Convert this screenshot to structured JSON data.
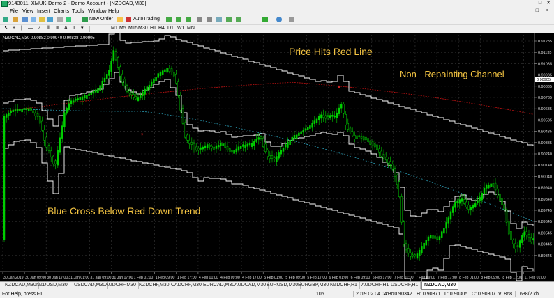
{
  "window": {
    "title": "9143011: XMUK-Demo 2 - Demo Account - [NZDCAD,M30]",
    "controls": [
      "–",
      "□",
      "✕"
    ]
  },
  "menu": {
    "items": [
      "File",
      "View",
      "Insert",
      "Charts",
      "Tools",
      "Window",
      "Help"
    ],
    "mdi_controls": "_ □ ×"
  },
  "toolbar": {
    "new_order": "New Order",
    "autotrading": "AutoTrading",
    "timeframes": [
      "M1",
      "M5",
      "M15",
      "M30",
      "H1",
      "H4",
      "D1",
      "W1",
      "MN"
    ]
  },
  "chart": {
    "header": "NZDCAD,M30  0.90882 0.90940 0.90838 0.90905",
    "annotations": {
      "price_hits": "Price Hits Red Line",
      "channel": "Non - Repainting Channel",
      "blue_cross": "Blue Cross Below Red Down Trend"
    },
    "price_labels": [
      "0.91235",
      "0.91135",
      "0.91035",
      "0.90935",
      "0.90835",
      "0.90735",
      "0.90635",
      "0.90535",
      "0.90435",
      "0.90335",
      "0.90240",
      "0.90140",
      "0.90040",
      "0.89940",
      "0.89840",
      "0.89745",
      "0.89645",
      "0.89545",
      "0.89445",
      "0.89345"
    ],
    "current_price": "0.90905",
    "time_labels": [
      "30 Jan 2019",
      "30 Jan 09:00",
      "30 Jan 17:00",
      "31 Jan 01:00",
      "31 Jan 09:00",
      "31 Jan 17:00",
      "1 Feb 01:00",
      "1 Feb 09:00",
      "1 Feb 17:00",
      "4 Feb 01:00",
      "4 Feb 09:00",
      "4 Feb 17:00",
      "5 Feb 01:00",
      "5 Feb 09:00",
      "5 Feb 17:00",
      "6 Feb 01:00",
      "6 Feb 09:00",
      "6 Feb 17:00",
      "7 Feb 01:00",
      "7 Feb 09:00",
      "7 Feb 17:00",
      "8 Feb 01:00",
      "8 Feb 09:00",
      "8 Feb 17:00",
      "11 Feb 01:00"
    ],
    "colors": {
      "background": "#000000",
      "bull": "#00d000",
      "bear": "#00a000",
      "channel": "#ffffff",
      "red_trend": "#b01010",
      "blue_trend": "#2a9db5",
      "annotation_text": "#f5c542"
    }
  },
  "tabs": [
    "NZDCAD,M30",
    "NZDUSD,M30",
    "USDCAD,M30",
    "AUDCHF,M30",
    "NZDCHF,M30",
    "CADCHF,M30",
    "EURCAD,M30",
    "AUDCAD,M30",
    "EURUSD,M30",
    "EURGBP,M30",
    "NZDCHF,H1",
    "AUDCHF,H1",
    "USDCHF,H1",
    "NZDCAD,M30"
  ],
  "active_tab": 13,
  "status": {
    "help": "For Help, press F1",
    "bars": "105",
    "datetime": "2019.02.04 04:30",
    "open": "O: 0.90342",
    "high": "H: 0.90371",
    "low": "L: 0.90305",
    "close": "C: 0.90307",
    "volume": "V: 868",
    "traffic": "638/2 kb"
  }
}
